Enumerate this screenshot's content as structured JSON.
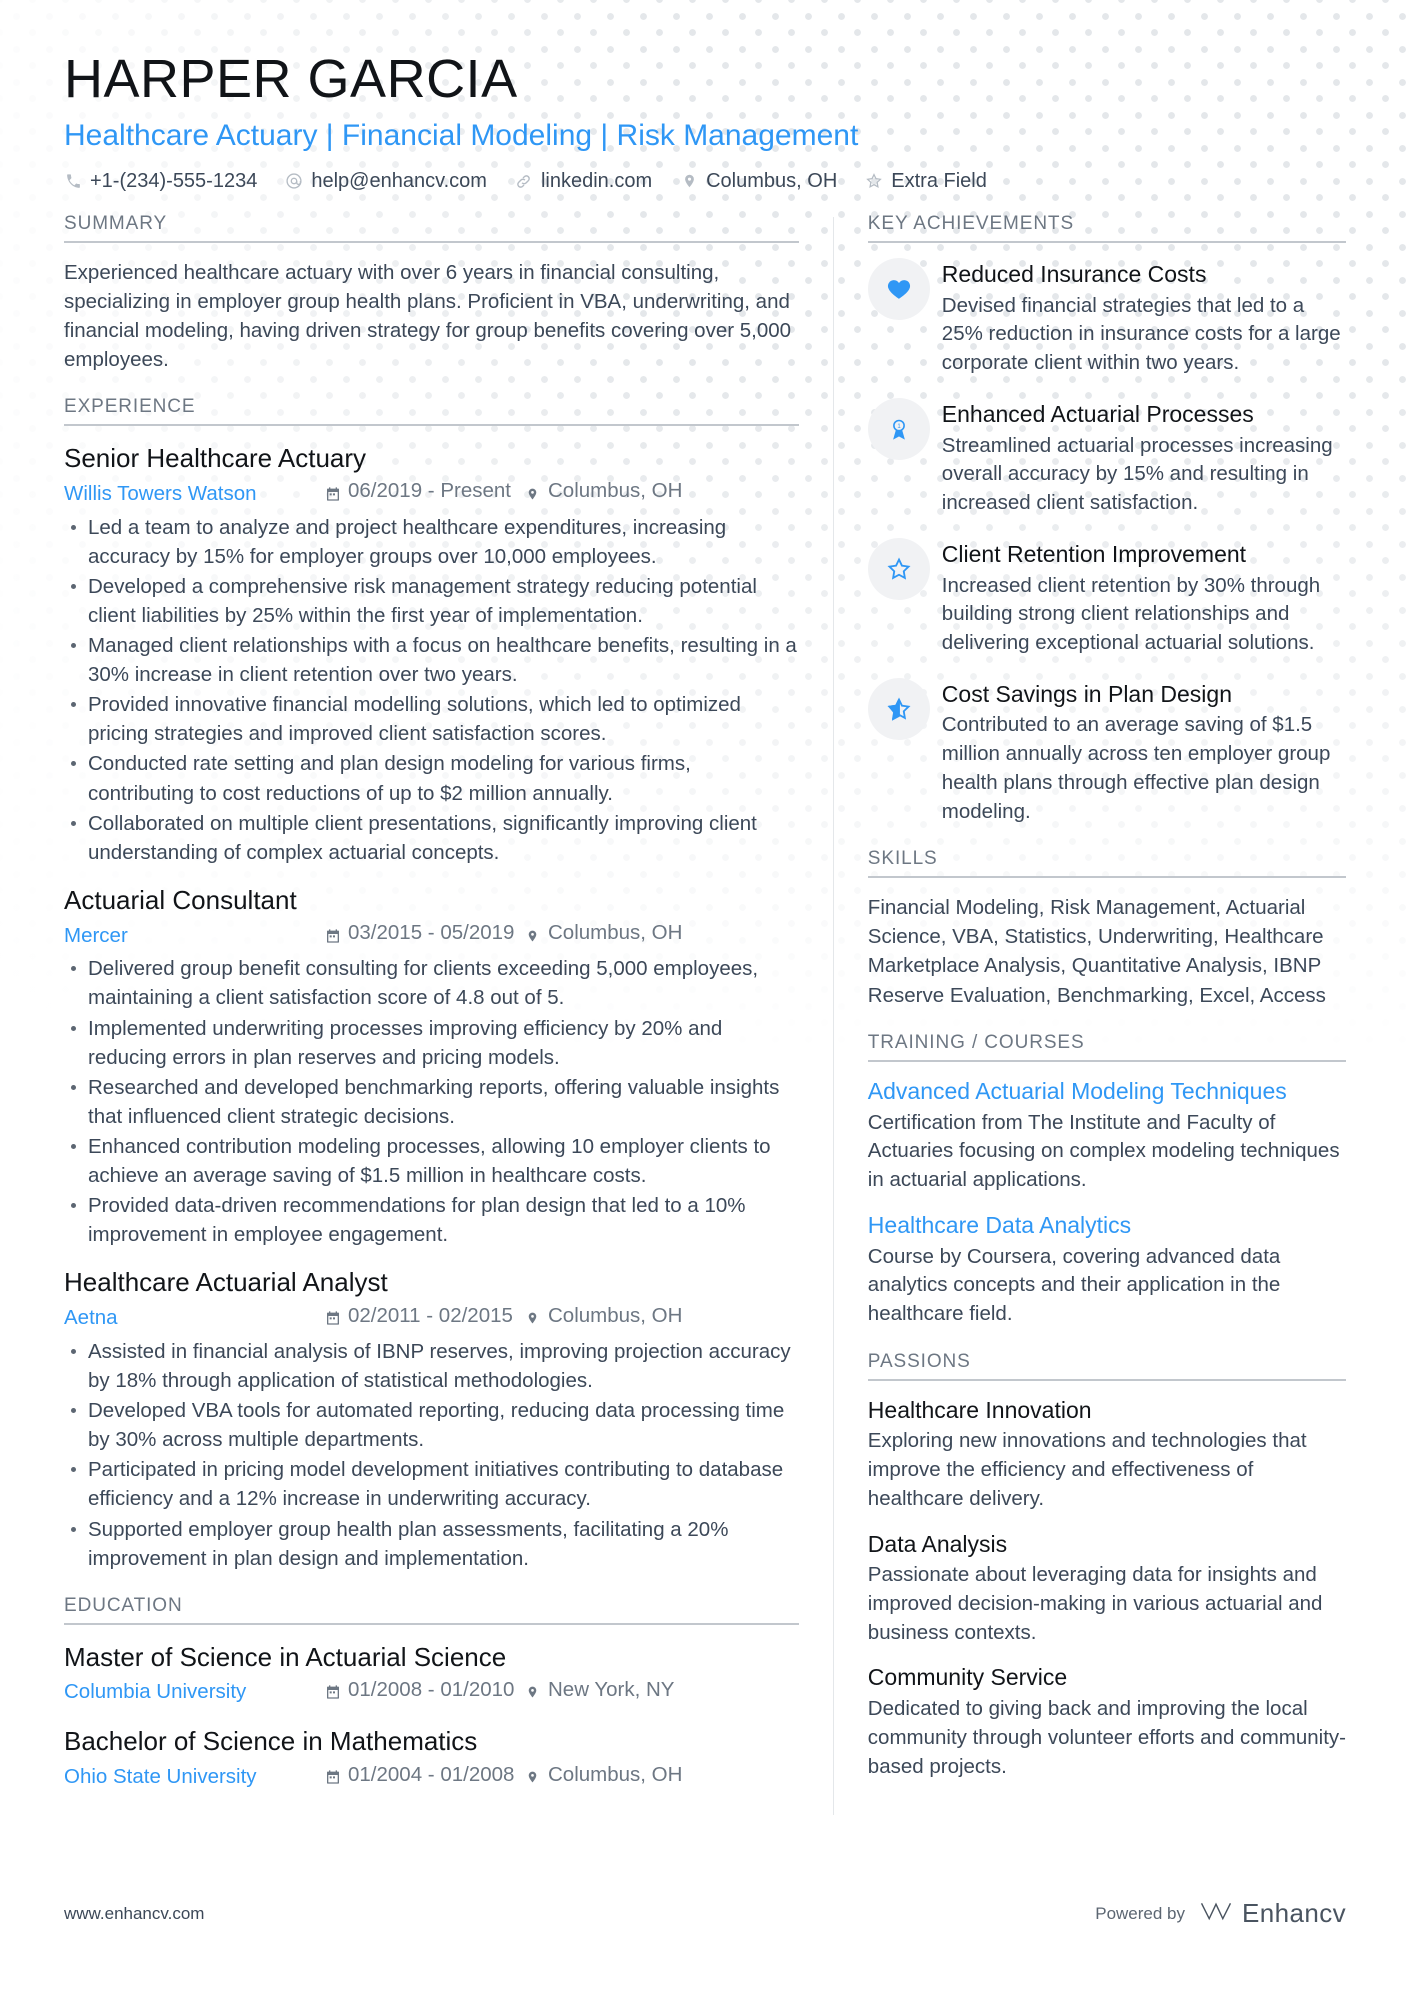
{
  "header": {
    "name": "HARPER GARCIA",
    "headline": "Healthcare Actuary | Financial Modeling | Risk Management",
    "contacts": [
      {
        "icon": "phone-icon",
        "text": "+1-(234)-555-1234"
      },
      {
        "icon": "email-icon",
        "text": "help@enhancv.com"
      },
      {
        "icon": "link-icon",
        "text": "linkedin.com"
      },
      {
        "icon": "location-pin-icon",
        "text": "Columbus, OH"
      },
      {
        "icon": "star-outline-icon",
        "text": "Extra Field"
      }
    ]
  },
  "left": {
    "summary": {
      "heading": "SUMMARY",
      "text": "Experienced healthcare actuary with over 6 years in financial consulting, specializing in employer group health plans. Proficient in VBA, underwriting, and financial modeling, having driven strategy for group benefits covering over 5,000 employees."
    },
    "experience": {
      "heading": "EXPERIENCE",
      "entries": [
        {
          "title": "Senior Healthcare Actuary",
          "org": "Willis Towers Watson",
          "date": "06/2019 - Present",
          "location": "Columbus, OH",
          "bullets": [
            "Led a team to analyze and project healthcare expenditures, increasing accuracy by 15% for employer groups over 10,000 employees.",
            "Developed a comprehensive risk management strategy reducing potential client liabilities by 25% within the first year of implementation.",
            "Managed client relationships with a focus on healthcare benefits, resulting in a 30% increase in client retention over two years.",
            "Provided innovative financial modelling solutions, which led to optimized pricing strategies and improved client satisfaction scores.",
            "Conducted rate setting and plan design modeling for various firms, contributing to cost reductions of up to $2 million annually.",
            "Collaborated on multiple client presentations, significantly improving client understanding of complex actuarial concepts."
          ]
        },
        {
          "title": "Actuarial Consultant",
          "org": "Mercer",
          "date": "03/2015 - 05/2019",
          "location": "Columbus, OH",
          "bullets": [
            "Delivered group benefit consulting for clients exceeding 5,000 employees, maintaining a client satisfaction score of 4.8 out of 5.",
            "Implemented underwriting processes improving efficiency by 20% and reducing errors in plan reserves and pricing models.",
            "Researched and developed benchmarking reports, offering valuable insights that influenced client strategic decisions.",
            "Enhanced contribution modeling processes, allowing 10 employer clients to achieve an average saving of $1.5 million in healthcare costs.",
            "Provided data-driven recommendations for plan design that led to a 10% improvement in employee engagement."
          ]
        },
        {
          "title": "Healthcare Actuarial Analyst",
          "org": "Aetna",
          "date": "02/2011 - 02/2015",
          "location": "Columbus, OH",
          "bullets": [
            "Assisted in financial analysis of IBNP reserves, improving projection accuracy by 18% through application of statistical methodologies.",
            "Developed VBA tools for automated reporting, reducing data processing time by 30% across multiple departments.",
            "Participated in pricing model development initiatives contributing to database efficiency and a 12% increase in underwriting accuracy.",
            "Supported employer group health plan assessments, facilitating a 20% improvement in plan design and implementation."
          ]
        }
      ]
    },
    "education": {
      "heading": "EDUCATION",
      "entries": [
        {
          "title": "Master of Science in Actuarial Science",
          "org": "Columbia University",
          "date": "01/2008 - 01/2010",
          "location": "New York, NY"
        },
        {
          "title": "Bachelor of Science in Mathematics",
          "org": "Ohio State University",
          "date": "01/2004 - 01/2008",
          "location": "Columbus, OH"
        }
      ]
    }
  },
  "right": {
    "achievements": {
      "heading": "KEY ACHIEVEMENTS",
      "items": [
        {
          "icon": "heart-icon",
          "title": "Reduced Insurance Costs",
          "text": "Devised financial strategies that led to a 25% reduction in insurance costs for a large corporate client within two years."
        },
        {
          "icon": "award-ribbon-icon",
          "title": "Enhanced Actuarial Processes",
          "text": "Streamlined actuarial processes increasing overall accuracy by 15% and resulting in increased client satisfaction."
        },
        {
          "icon": "star-outline-icon",
          "title": "Client Retention Improvement",
          "text": "Increased client retention by 30% through building strong client relationships and delivering exceptional actuarial solutions."
        },
        {
          "icon": "star-half-icon",
          "title": "Cost Savings in Plan Design",
          "text": "Contributed to an average saving of $1.5 million annually across ten employer group health plans through effective plan design modeling."
        }
      ]
    },
    "skills": {
      "heading": "SKILLS",
      "text": "Financial Modeling, Risk Management, Actuarial Science, VBA, Statistics, Underwriting, Healthcare Marketplace Analysis, Quantitative Analysis, IBNP Reserve Evaluation, Benchmarking, Excel, Access"
    },
    "training": {
      "heading": "TRAINING / COURSES",
      "items": [
        {
          "title": "Advanced Actuarial Modeling Techniques",
          "text": "Certification from The Institute and Faculty of Actuaries focusing on complex modeling techniques in actuarial applications."
        },
        {
          "title": "Healthcare Data Analytics",
          "text": "Course by Coursera, covering advanced data analytics concepts and their application in the healthcare field."
        }
      ]
    },
    "passions": {
      "heading": "PASSIONS",
      "items": [
        {
          "title": "Healthcare Innovation",
          "text": "Exploring new innovations and technologies that improve the efficiency and effectiveness of healthcare delivery."
        },
        {
          "title": "Data Analysis",
          "text": "Passionate about leveraging data for insights and improved decision-making in various actuarial and business contexts."
        },
        {
          "title": "Community Service",
          "text": "Dedicated to giving back and improving the local community through volunteer efforts and community-based projects."
        }
      ]
    }
  },
  "footer": {
    "url": "www.enhancv.com",
    "powered_by": "Powered by",
    "brand": "Enhancv"
  },
  "colors": {
    "accent": "#2f97f5",
    "heading": "#6d7783",
    "text": "#3c4858",
    "rule": "#c2c7cd"
  }
}
